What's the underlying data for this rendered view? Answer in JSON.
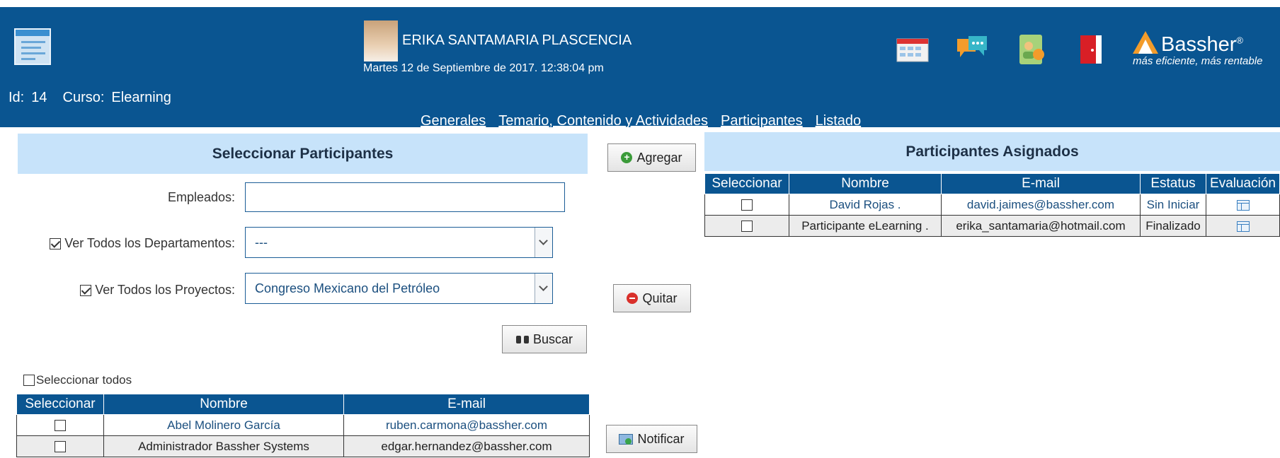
{
  "header": {
    "user_name": "ERIKA SANTAMARIA PLASCENCIA",
    "datetime": "Martes 12 de Septiembre de 2017. 12:38:04 pm",
    "icons": [
      "calendar-icon",
      "chat-icon",
      "tablet-user-icon",
      "exit-door-icon"
    ],
    "brand": {
      "name": "Bassher",
      "reg": "®",
      "tagline": "más eficiente, más rentable"
    }
  },
  "course": {
    "id_label": "Id:",
    "id_value": "14",
    "course_label": "Curso:",
    "course_value": "Elearning"
  },
  "tabs": [
    "Generales",
    "Temario, Contenido y Actividades",
    "Participantes",
    "Listado"
  ],
  "left_panel": {
    "title": "Seleccionar Participantes",
    "empleados_label": "Empleados:",
    "empleados_value": "",
    "departamentos_label": "Ver Todos los Departamentos:",
    "departamentos_checked": true,
    "departamentos_value": "---",
    "proyectos_label": "Ver Todos los Proyectos:",
    "proyectos_checked": true,
    "proyectos_value": "Congreso Mexicano del Petróleo",
    "search_button": "Buscar",
    "select_all_label": "Seleccionar todos",
    "columns": [
      "Seleccionar",
      "Nombre",
      "E-mail"
    ],
    "rows": [
      {
        "nombre": "Abel Molinero García",
        "email": "ruben.carmona@bassher.com"
      },
      {
        "nombre": "Administrador Bassher Systems",
        "email": "edgar.hernandez@bassher.com"
      }
    ]
  },
  "actions": {
    "add": "Agregar",
    "remove": "Quitar",
    "notify": "Notificar"
  },
  "right_panel": {
    "title": "Participantes Asignados",
    "columns": [
      "Seleccionar",
      "Nombre",
      "E-mail",
      "Estatus",
      "Evaluación"
    ],
    "rows": [
      {
        "nombre": "David Rojas .",
        "email": "david.jaimes@bassher.com",
        "estatus": "Sin Iniciar"
      },
      {
        "nombre": "Participante eLearning .",
        "email": "erika_santamaria@hotmail.com",
        "estatus": "Finalizado"
      }
    ]
  }
}
